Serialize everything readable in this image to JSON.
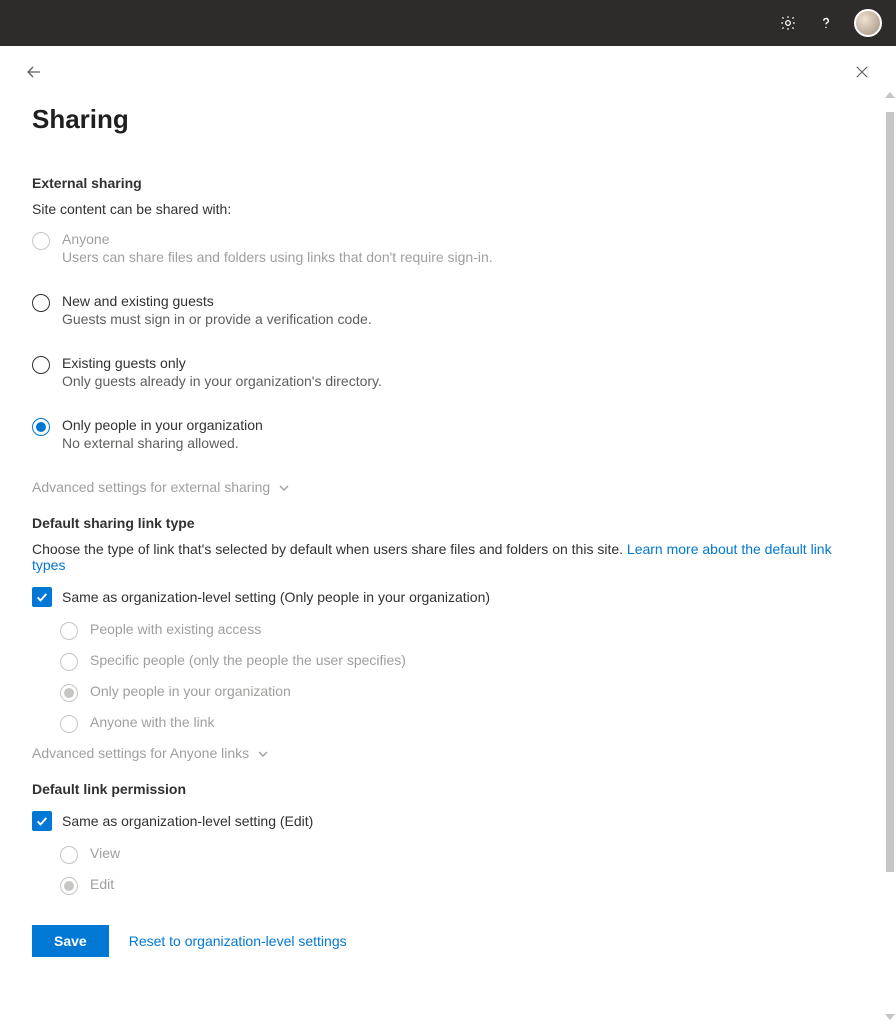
{
  "page": {
    "title": "Sharing"
  },
  "external": {
    "title": "External sharing",
    "sub": "Site content can be shared with:",
    "options": [
      {
        "label": "Anyone",
        "desc": "Users can share files and folders using links that don't require sign-in.",
        "state": "disabled"
      },
      {
        "label": "New and existing guests",
        "desc": "Guests must sign in or provide a verification code.",
        "state": "enabled"
      },
      {
        "label": "Existing guests only",
        "desc": "Only guests already in your organization's directory.",
        "state": "enabled"
      },
      {
        "label": "Only people in your organization",
        "desc": "No external sharing allowed.",
        "state": "selected"
      }
    ],
    "advanced": "Advanced settings for external sharing"
  },
  "defaultLink": {
    "title": "Default sharing link type",
    "sub": "Choose the type of link that's selected by default when users share files and folders on this site. ",
    "learn": "Learn more about the default link types",
    "sameAs": "Same as organization-level setting (Only people in your organization)",
    "options": [
      {
        "label": "People with existing access",
        "state": "disabled"
      },
      {
        "label": "Specific people (only the people the user specifies)",
        "state": "disabled"
      },
      {
        "label": "Only people in your organization",
        "state": "disabled-filled"
      },
      {
        "label": "Anyone with the link",
        "state": "disabled"
      }
    ],
    "advanced": "Advanced settings for Anyone links"
  },
  "permission": {
    "title": "Default link permission",
    "sameAs": "Same as organization-level setting (Edit)",
    "options": [
      {
        "label": "View",
        "state": "disabled"
      },
      {
        "label": "Edit",
        "state": "disabled-filled"
      }
    ]
  },
  "footer": {
    "save": "Save",
    "reset": "Reset to organization-level settings"
  }
}
